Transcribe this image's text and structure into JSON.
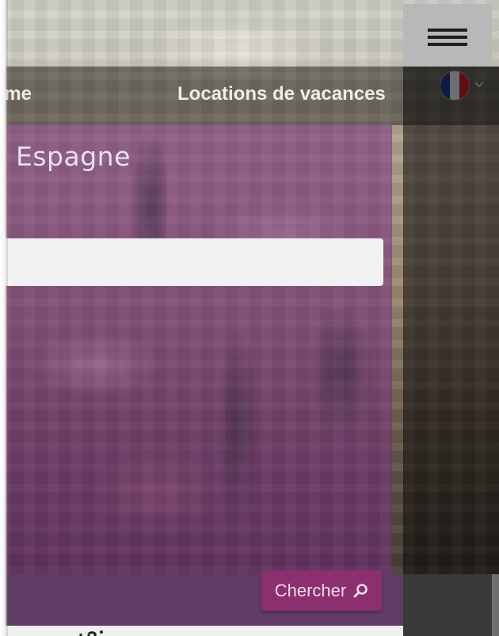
{
  "nav": {
    "home_label": "Home",
    "rentals_label": "Locations de vacances",
    "language_icon": "france-flag-icon",
    "flag_colors": [
      "#1f3a93",
      "#f4f4f4",
      "#d21f26"
    ]
  },
  "hero": {
    "title": "Espagne",
    "search_placeholder": ""
  },
  "search_button": {
    "label": "Chercher",
    "icon": "search-icon"
  },
  "colors": {
    "hero_overlay": "#702878",
    "button": "#8c2f6f"
  }
}
